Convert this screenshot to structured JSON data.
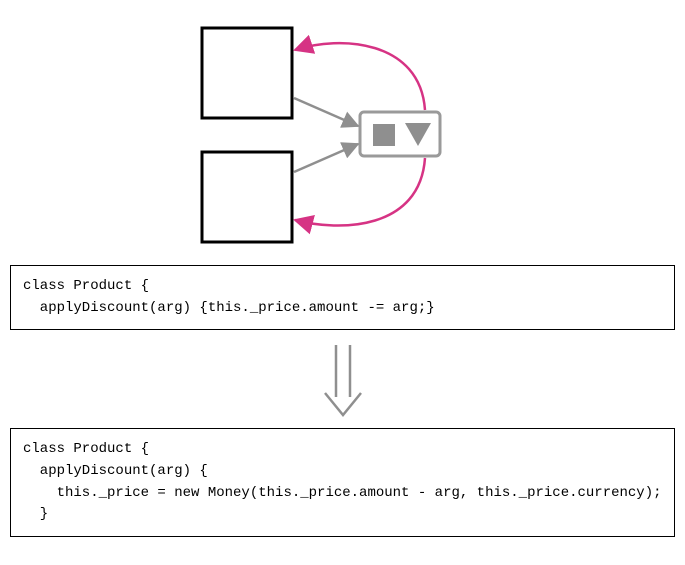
{
  "code_before": "class Product {\n  applyDiscount(arg) {this._price.amount -= arg;}",
  "code_after": "class Product {\n  applyDiscount(arg) {\n    this._price = new Money(this._price.amount - arg, this._price.currency);\n  }",
  "colors": {
    "box_stroke": "#000000",
    "panel_stroke": "#9a9a9a",
    "arrow_gray": "#8f8f8f",
    "arrow_pink": "#d63384",
    "shape_fill": "#8f8f8f"
  },
  "diagram": {
    "boxes": [
      "top-left-box",
      "bottom-left-box"
    ],
    "shared_panel": "shared-value-panel",
    "panel_icons": [
      "square-icon",
      "triangle-down-icon"
    ],
    "forward_arrows": 2,
    "back_arrows": 2
  }
}
